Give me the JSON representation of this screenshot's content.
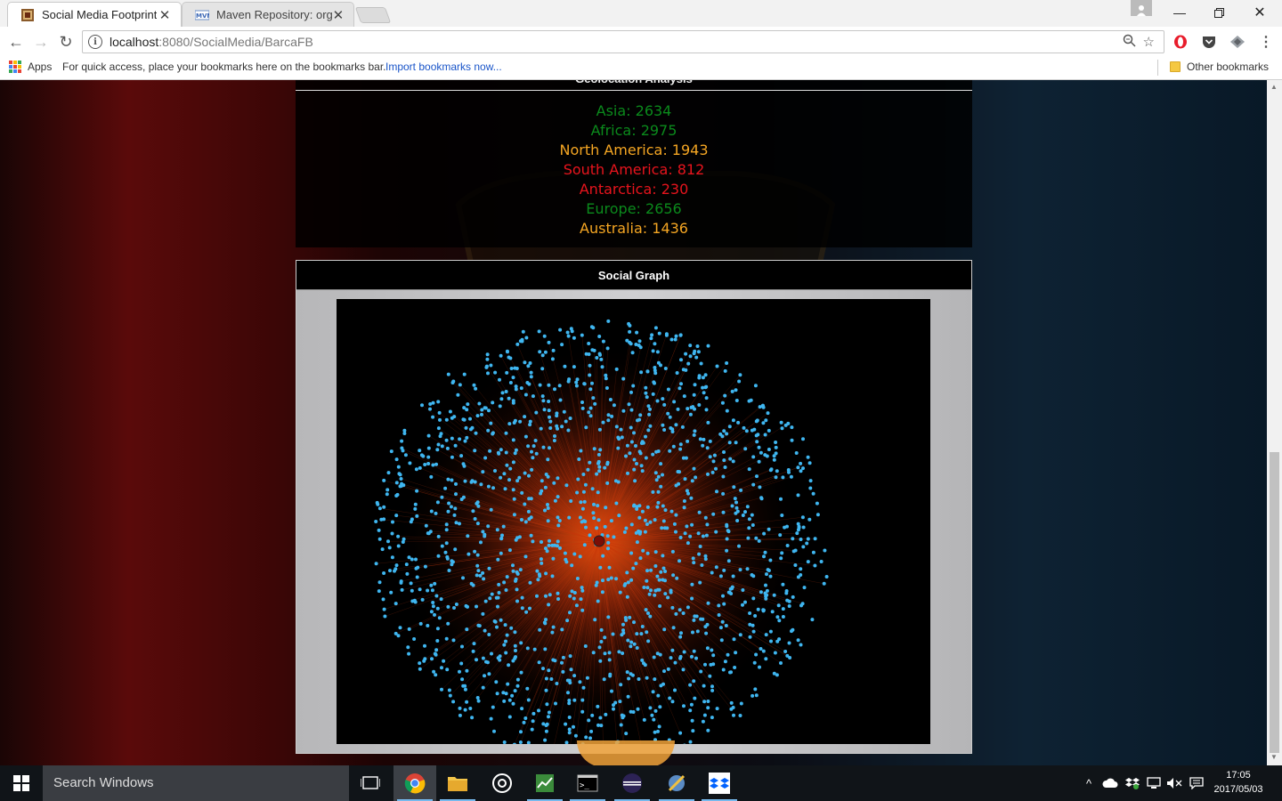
{
  "browser": {
    "tabs": [
      {
        "title": "Social Media Footprint",
        "active": true
      },
      {
        "title": "Maven Repository: org.m",
        "active": false
      }
    ],
    "url_host": "localhost",
    "url_path": ":8080/SocialMedia/BarcaFB",
    "bookmarks_bar": {
      "apps_label": "Apps",
      "hint": "For quick access, place your bookmarks here on the bookmarks bar.",
      "import_link": "Import bookmarks now...",
      "other_bookmarks": "Other bookmarks"
    }
  },
  "page": {
    "geo_panel": {
      "header": "Geolocation Analysis",
      "items": [
        {
          "label": "Asia: 2634",
          "color": "#0b8a1c"
        },
        {
          "label": "Africa: 2975",
          "color": "#0b8a1c"
        },
        {
          "label": "North America: 1943",
          "color": "#f5a623"
        },
        {
          "label": "South America: 812",
          "color": "#e8141d"
        },
        {
          "label": "Antarctica: 230",
          "color": "#e8141d"
        },
        {
          "label": "Europe: 2656",
          "color": "#0b8a1c"
        },
        {
          "label": "Australia: 1436",
          "color": "#f5a623"
        }
      ]
    },
    "social_graph": {
      "title": "Social Graph",
      "node_color": "#3fb6f0",
      "edge_color": "#c83a10",
      "center_color": "#7a0e06"
    }
  },
  "taskbar": {
    "search_placeholder": "Search Windows",
    "time": "17:05",
    "date": "2017/05/03"
  }
}
